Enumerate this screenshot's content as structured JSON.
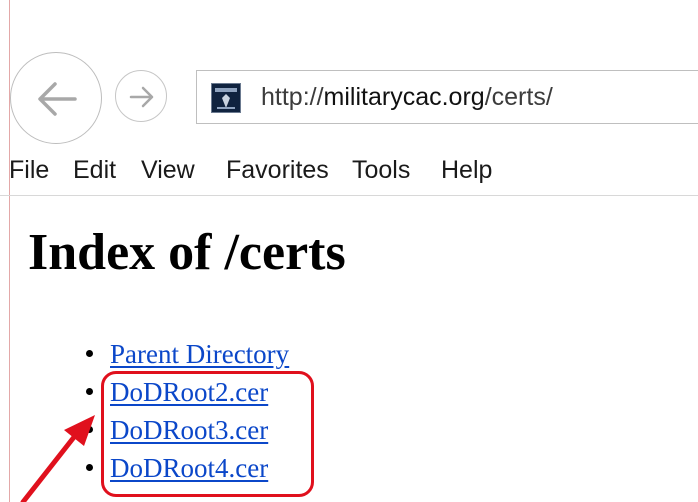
{
  "browser": {
    "address_bar": {
      "protocol": "http://",
      "domain": "militarycac.org",
      "path": "/certs/"
    },
    "favicon_icon": "military-seal-icon",
    "back_icon": "back-arrow-icon",
    "forward_icon": "forward-arrow-icon"
  },
  "menu_bar": {
    "items": [
      "File",
      "Edit",
      "View",
      "Favorites",
      "Tools",
      "Help"
    ]
  },
  "page": {
    "title": "Index of /certs",
    "files": [
      "Parent Directory",
      "DoDRoot2.cer",
      "DoDRoot3.cer",
      "DoDRoot4.cer"
    ]
  },
  "annotation": {
    "highlight_color": "#e0101d",
    "arrow_color": "#e0101d"
  },
  "colors": {
    "link": "#0b47c9"
  }
}
